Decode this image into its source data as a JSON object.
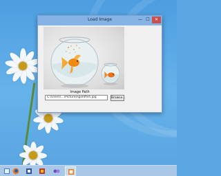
{
  "window": {
    "title": "Load Image",
    "min_glyph": "—",
    "max_glyph": "☐",
    "close_glyph": "✕"
  },
  "form": {
    "image_caption": "Image Path",
    "path_value": "C:\\Users\\...\\Pictures\\goldfish.jpg",
    "browse_label": "Browse..."
  },
  "taskbar": {
    "items": [
      {
        "icon": "explorer-icon"
      },
      {
        "icon": "firefox-icon"
      },
      {
        "icon": "word-icon"
      },
      {
        "icon": "app-icon"
      },
      {
        "icon": "network-icon"
      },
      {
        "icon": "form-app-icon"
      }
    ]
  },
  "colors": {
    "desktop_blue": "#5aa7e3",
    "titlebar": "#85b3e6",
    "close_button": "#c75050",
    "taskbar": "#a9c8e8"
  }
}
